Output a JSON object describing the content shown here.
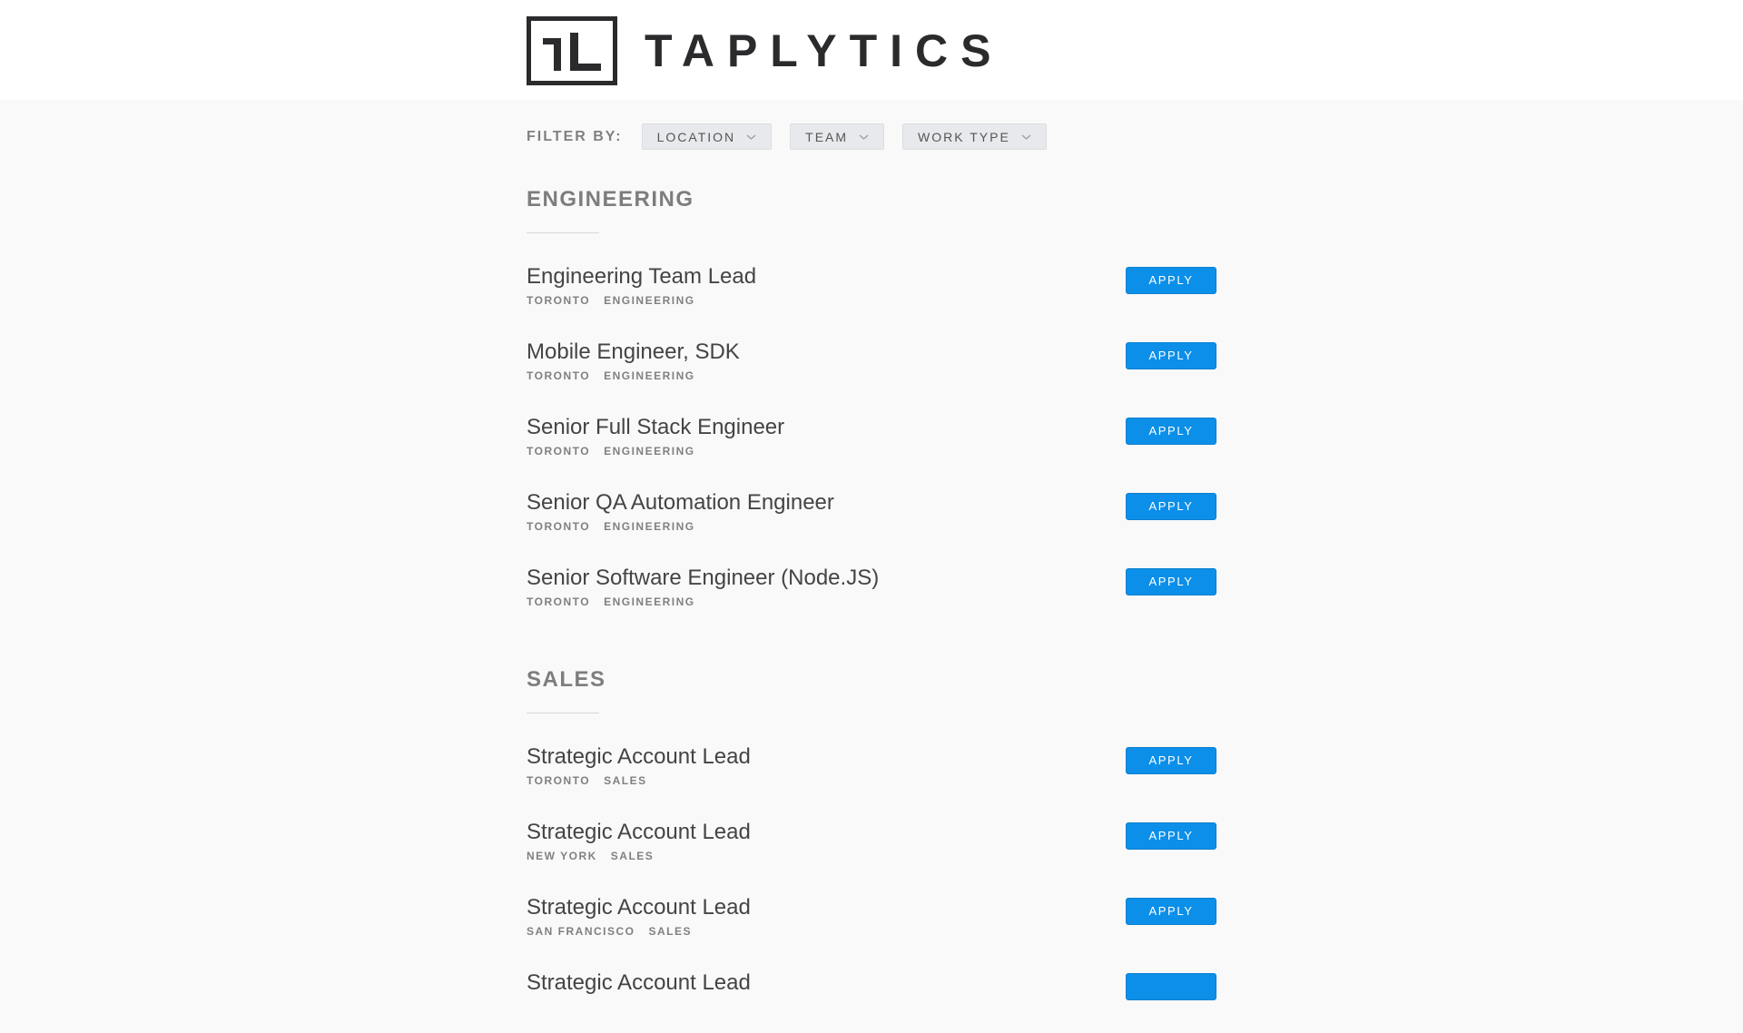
{
  "header": {
    "logo_text": "TAPLYTICS",
    "logo_mark": "tl-monogram-logo"
  },
  "filter": {
    "label": "FILTER BY:",
    "buttons": [
      {
        "label": "LOCATION",
        "icon": "chevron-down-icon"
      },
      {
        "label": "TEAM",
        "icon": "chevron-down-icon"
      },
      {
        "label": "WORK TYPE",
        "icon": "chevron-down-icon"
      }
    ]
  },
  "sections": [
    {
      "title": "ENGINEERING",
      "postings": [
        {
          "title": "Engineering Team Lead",
          "location": "TORONTO",
          "team": "ENGINEERING",
          "apply": "APPLY"
        },
        {
          "title": "Mobile Engineer, SDK",
          "location": "TORONTO",
          "team": "ENGINEERING",
          "apply": "APPLY"
        },
        {
          "title": "Senior Full Stack Engineer",
          "location": "TORONTO",
          "team": "ENGINEERING",
          "apply": "APPLY"
        },
        {
          "title": "Senior QA Automation Engineer",
          "location": "TORONTO",
          "team": "ENGINEERING",
          "apply": "APPLY"
        },
        {
          "title": "Senior Software Engineer (Node.JS)",
          "location": "TORONTO",
          "team": "ENGINEERING",
          "apply": "APPLY"
        }
      ]
    },
    {
      "title": "SALES",
      "postings": [
        {
          "title": "Strategic Account Lead",
          "location": "TORONTO",
          "team": "SALES",
          "apply": "APPLY"
        },
        {
          "title": "Strategic Account Lead",
          "location": "NEW YORK",
          "team": "SALES",
          "apply": "APPLY"
        },
        {
          "title": "Strategic Account Lead",
          "location": "SAN FRANCISCO",
          "team": "SALES",
          "apply": "APPLY"
        },
        {
          "title": "Strategic Account Lead",
          "location": "",
          "team": "",
          "apply": ""
        }
      ]
    }
  ],
  "colors": {
    "accent": "#0c8fe8",
    "background": "#f9f9f9",
    "header_bg": "#ffffff"
  }
}
